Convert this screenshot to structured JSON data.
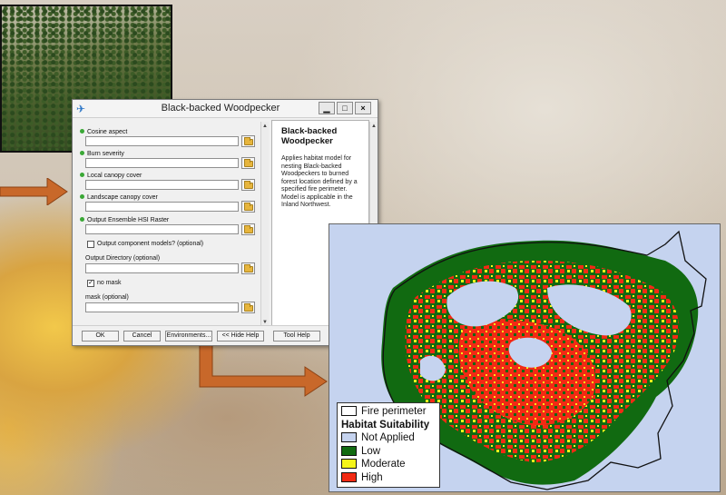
{
  "dialog": {
    "title": "Black-backed Woodpecker",
    "min_glyph": "▁",
    "max_glyph": "□",
    "close_glyph": "×",
    "fields": [
      {
        "label": "Cosine aspect",
        "required": true,
        "value": ""
      },
      {
        "label": "Burn severity",
        "required": true,
        "value": ""
      },
      {
        "label": "Local canopy cover",
        "required": true,
        "value": ""
      },
      {
        "label": "Landscape canopy cover",
        "required": true,
        "value": ""
      },
      {
        "label": "Output Ensemble HSI Raster",
        "required": true,
        "value": ""
      }
    ],
    "checkbox_component": {
      "label": "Output component models? (optional)",
      "checked": false
    },
    "output_dir": {
      "label": "Output Directory (optional)",
      "value": ""
    },
    "checkbox_nomask": {
      "label": "no mask",
      "checked": true,
      "glyph": "✓"
    },
    "mask": {
      "label": "mask (optional)",
      "value": ""
    },
    "help": {
      "title": "Black-backed Woodpecker",
      "body": "Applies habitat model for nesting Black-backed Woodpeckers to burned forest location defined by a specified fire perimeter. Model is applicable in the Inland Northwest."
    },
    "buttons": {
      "ok": "OK",
      "cancel": "Cancel",
      "environments": "Environments...",
      "hide_help": "<< Hide Help",
      "tool_help": "Tool Help"
    }
  },
  "legend": {
    "perimeter": "Fire perimeter",
    "heading": "Habitat Suitability",
    "classes": [
      {
        "label": "Not Applied",
        "color": "#c5d3ef"
      },
      {
        "label": "Low",
        "color": "#116a11"
      },
      {
        "label": "Moderate",
        "color": "#f5f51a"
      },
      {
        "label": "High",
        "color": "#f22a14"
      }
    ]
  },
  "colors": {
    "arrow": "#c8682a",
    "required_dot": "#3aa836"
  }
}
